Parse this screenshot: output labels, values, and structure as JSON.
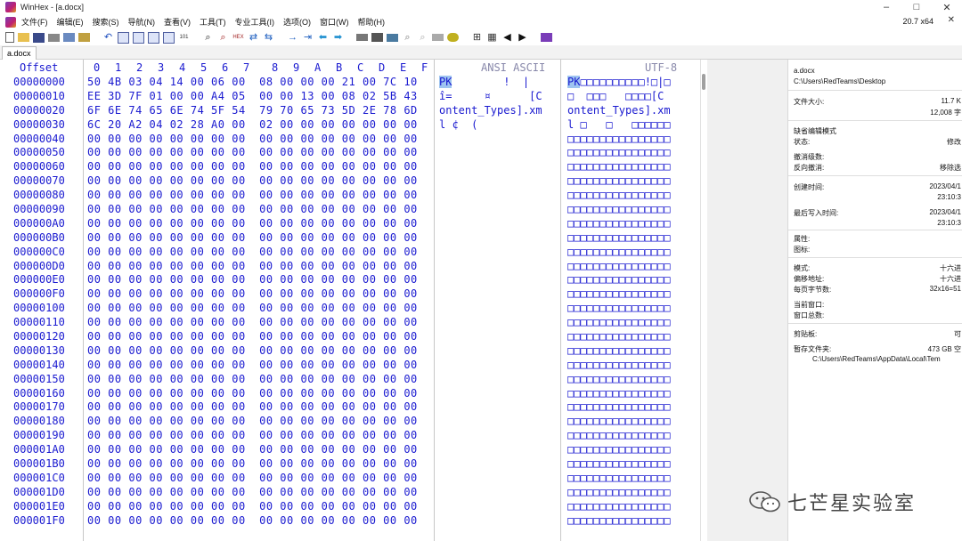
{
  "window": {
    "title": "WinHex - [a.docx]",
    "minimize": "–",
    "maximize": "□",
    "close": "✕",
    "version": "20.7 x64",
    "menu_close": "✕"
  },
  "menu": [
    "文件(F)",
    "编辑(E)",
    "搜索(S)",
    "导航(N)",
    "查看(V)",
    "工具(T)",
    "专业工具(I)",
    "选项(O)",
    "窗口(W)",
    "帮助(H)"
  ],
  "toolbar_icons": [
    "new-file-icon",
    "open-folder-icon",
    "save-icon",
    "print-icon",
    "properties-icon",
    "open-disk-icon",
    "undo-icon",
    "copy-block-icon",
    "clipboard-icon",
    "paste-icon",
    "copy-hex-icon",
    "write-hex-icon",
    "find-text-icon",
    "find-hex-icon",
    "replace-text-icon",
    "replace-hex-icon",
    "goto-offset-icon",
    "goto-sector-icon",
    "back-icon",
    "forward-icon",
    "disk-editor-icon",
    "ram-editor-icon",
    "calculator-icon",
    "zoom-icon",
    "bookmark-icon",
    "mark-icon",
    "data-interpreter-icon",
    "hash-icon",
    "block-start-icon",
    "block-end-icon",
    "book-icon"
  ],
  "tab": {
    "label": "a.docx"
  },
  "editor": {
    "header": {
      "offset": "Offset",
      "hex_cols": [
        "0",
        "1",
        "2",
        "3",
        "4",
        "5",
        "6",
        "7",
        "8",
        "9",
        "A",
        "B",
        "C",
        "D",
        "E",
        "F"
      ],
      "ansi": "ANSI ASCII",
      "utf8": "UTF-8"
    },
    "rows": [
      {
        "off": "00000000",
        "hex": "50 4B 03 04 14 00 06 00  08 00 00 00 21 00 7C 10",
        "ansi_hl": "PK",
        "ansi": "        !  |",
        "utf_hl": "PK",
        "utf": "□□□□□□□□□□!□|□"
      },
      {
        "off": "00000010",
        "hex": "EE 3D 7F 01 00 00 A4 05  00 00 13 00 08 02 5B 43",
        "ansi": "î=     ¤      [C",
        "utf": "□  □□□   □□□□[C"
      },
      {
        "off": "00000020",
        "hex": "6F 6E 74 65 6E 74 5F 54  79 70 65 73 5D 2E 78 6D",
        "ansi": "ontent_Types].xm",
        "utf": "ontent_Types].xm"
      },
      {
        "off": "00000030",
        "hex": "6C 20 A2 04 02 28 A0 00  02 00 00 00 00 00 00 00",
        "ansi": "l ¢  (",
        "utf": "l □   □   □□□□□□"
      },
      {
        "off": "00000040",
        "hex": "00 00 00 00 00 00 00 00  00 00 00 00 00 00 00 00",
        "ansi": "",
        "utf": "□□□□□□□□□□□□□□□□"
      },
      {
        "off": "00000050",
        "hex": "00 00 00 00 00 00 00 00  00 00 00 00 00 00 00 00",
        "ansi": "",
        "utf": "□□□□□□□□□□□□□□□□"
      },
      {
        "off": "00000060",
        "hex": "00 00 00 00 00 00 00 00  00 00 00 00 00 00 00 00",
        "ansi": "",
        "utf": "□□□□□□□□□□□□□□□□"
      },
      {
        "off": "00000070",
        "hex": "00 00 00 00 00 00 00 00  00 00 00 00 00 00 00 00",
        "ansi": "",
        "utf": "□□□□□□□□□□□□□□□□"
      },
      {
        "off": "00000080",
        "hex": "00 00 00 00 00 00 00 00  00 00 00 00 00 00 00 00",
        "ansi": "",
        "utf": "□□□□□□□□□□□□□□□□"
      },
      {
        "off": "00000090",
        "hex": "00 00 00 00 00 00 00 00  00 00 00 00 00 00 00 00",
        "ansi": "",
        "utf": "□□□□□□□□□□□□□□□□"
      },
      {
        "off": "000000A0",
        "hex": "00 00 00 00 00 00 00 00  00 00 00 00 00 00 00 00",
        "ansi": "",
        "utf": "□□□□□□□□□□□□□□□□"
      },
      {
        "off": "000000B0",
        "hex": "00 00 00 00 00 00 00 00  00 00 00 00 00 00 00 00",
        "ansi": "",
        "utf": "□□□□□□□□□□□□□□□□"
      },
      {
        "off": "000000C0",
        "hex": "00 00 00 00 00 00 00 00  00 00 00 00 00 00 00 00",
        "ansi": "",
        "utf": "□□□□□□□□□□□□□□□□"
      },
      {
        "off": "000000D0",
        "hex": "00 00 00 00 00 00 00 00  00 00 00 00 00 00 00 00",
        "ansi": "",
        "utf": "□□□□□□□□□□□□□□□□"
      },
      {
        "off": "000000E0",
        "hex": "00 00 00 00 00 00 00 00  00 00 00 00 00 00 00 00",
        "ansi": "",
        "utf": "□□□□□□□□□□□□□□□□"
      },
      {
        "off": "000000F0",
        "hex": "00 00 00 00 00 00 00 00  00 00 00 00 00 00 00 00",
        "ansi": "",
        "utf": "□□□□□□□□□□□□□□□□"
      },
      {
        "off": "00000100",
        "hex": "00 00 00 00 00 00 00 00  00 00 00 00 00 00 00 00",
        "ansi": "",
        "utf": "□□□□□□□□□□□□□□□□"
      },
      {
        "off": "00000110",
        "hex": "00 00 00 00 00 00 00 00  00 00 00 00 00 00 00 00",
        "ansi": "",
        "utf": "□□□□□□□□□□□□□□□□"
      },
      {
        "off": "00000120",
        "hex": "00 00 00 00 00 00 00 00  00 00 00 00 00 00 00 00",
        "ansi": "",
        "utf": "□□□□□□□□□□□□□□□□"
      },
      {
        "off": "00000130",
        "hex": "00 00 00 00 00 00 00 00  00 00 00 00 00 00 00 00",
        "ansi": "",
        "utf": "□□□□□□□□□□□□□□□□"
      },
      {
        "off": "00000140",
        "hex": "00 00 00 00 00 00 00 00  00 00 00 00 00 00 00 00",
        "ansi": "",
        "utf": "□□□□□□□□□□□□□□□□"
      },
      {
        "off": "00000150",
        "hex": "00 00 00 00 00 00 00 00  00 00 00 00 00 00 00 00",
        "ansi": "",
        "utf": "□□□□□□□□□□□□□□□□"
      },
      {
        "off": "00000160",
        "hex": "00 00 00 00 00 00 00 00  00 00 00 00 00 00 00 00",
        "ansi": "",
        "utf": "□□□□□□□□□□□□□□□□"
      },
      {
        "off": "00000170",
        "hex": "00 00 00 00 00 00 00 00  00 00 00 00 00 00 00 00",
        "ansi": "",
        "utf": "□□□□□□□□□□□□□□□□"
      },
      {
        "off": "00000180",
        "hex": "00 00 00 00 00 00 00 00  00 00 00 00 00 00 00 00",
        "ansi": "",
        "utf": "□□□□□□□□□□□□□□□□"
      },
      {
        "off": "00000190",
        "hex": "00 00 00 00 00 00 00 00  00 00 00 00 00 00 00 00",
        "ansi": "",
        "utf": "□□□□□□□□□□□□□□□□"
      },
      {
        "off": "000001A0",
        "hex": "00 00 00 00 00 00 00 00  00 00 00 00 00 00 00 00",
        "ansi": "",
        "utf": "□□□□□□□□□□□□□□□□"
      },
      {
        "off": "000001B0",
        "hex": "00 00 00 00 00 00 00 00  00 00 00 00 00 00 00 00",
        "ansi": "",
        "utf": "□□□□□□□□□□□□□□□□"
      },
      {
        "off": "000001C0",
        "hex": "00 00 00 00 00 00 00 00  00 00 00 00 00 00 00 00",
        "ansi": "",
        "utf": "□□□□□□□□□□□□□□□□"
      },
      {
        "off": "000001D0",
        "hex": "00 00 00 00 00 00 00 00  00 00 00 00 00 00 00 00",
        "ansi": "",
        "utf": "□□□□□□□□□□□□□□□□"
      },
      {
        "off": "000001E0",
        "hex": "00 00 00 00 00 00 00 00  00 00 00 00 00 00 00 00",
        "ansi": "",
        "utf": "□□□□□□□□□□□□□□□□"
      },
      {
        "off": "000001F0",
        "hex": "00 00 00 00 00 00 00 00  00 00 00 00 00 00 00 00",
        "ansi": "",
        "utf": "□□□□□□□□□□□□□□□□"
      }
    ]
  },
  "info_panel": {
    "filename": "a.docx",
    "path": "C:\\Users\\RedTeams\\Desktop",
    "size_label": "文件大小:",
    "size_kb": "11.7 K",
    "size_bytes": "12,008 字",
    "edit_mode_title": "缺省编辑模式",
    "status_label": "状态:",
    "status_value": "修改",
    "undo_level_label": "撤消级数:",
    "undo_reverse_label": "反向撤消:",
    "undo_reverse_value": "移除选",
    "created_label": "创建时间:",
    "created_date": "2023/04/1",
    "created_time": "23:10:3",
    "modified_label": "最后写入时间:",
    "modified_date": "2023/04/1",
    "modified_time": "23:10:3",
    "attr_label": "属性:",
    "icon_label": "图标:",
    "mode_label": "模式:",
    "mode_value": "十六进",
    "offset_label": "偏移地址:",
    "offset_value": "十六进",
    "bpp_label": "每页字节数:",
    "bpp_value": "32x16=51",
    "curwin_label": "当前窗口:",
    "wincount_label": "窗口总数:",
    "clipboard_label": "剪贴板:",
    "clipboard_value": "可",
    "temp_label": "暂存文件夹:",
    "temp_value": "473 GB 空",
    "temp_path": "C:\\Users\\RedTeams\\AppData\\Local\\Tem"
  },
  "watermark": {
    "text": "七芒星实验室"
  },
  "colors": {
    "hex_text": "#1a1ad0",
    "highlight": "#9ec4f0",
    "header_text": "#1a1ad0"
  }
}
